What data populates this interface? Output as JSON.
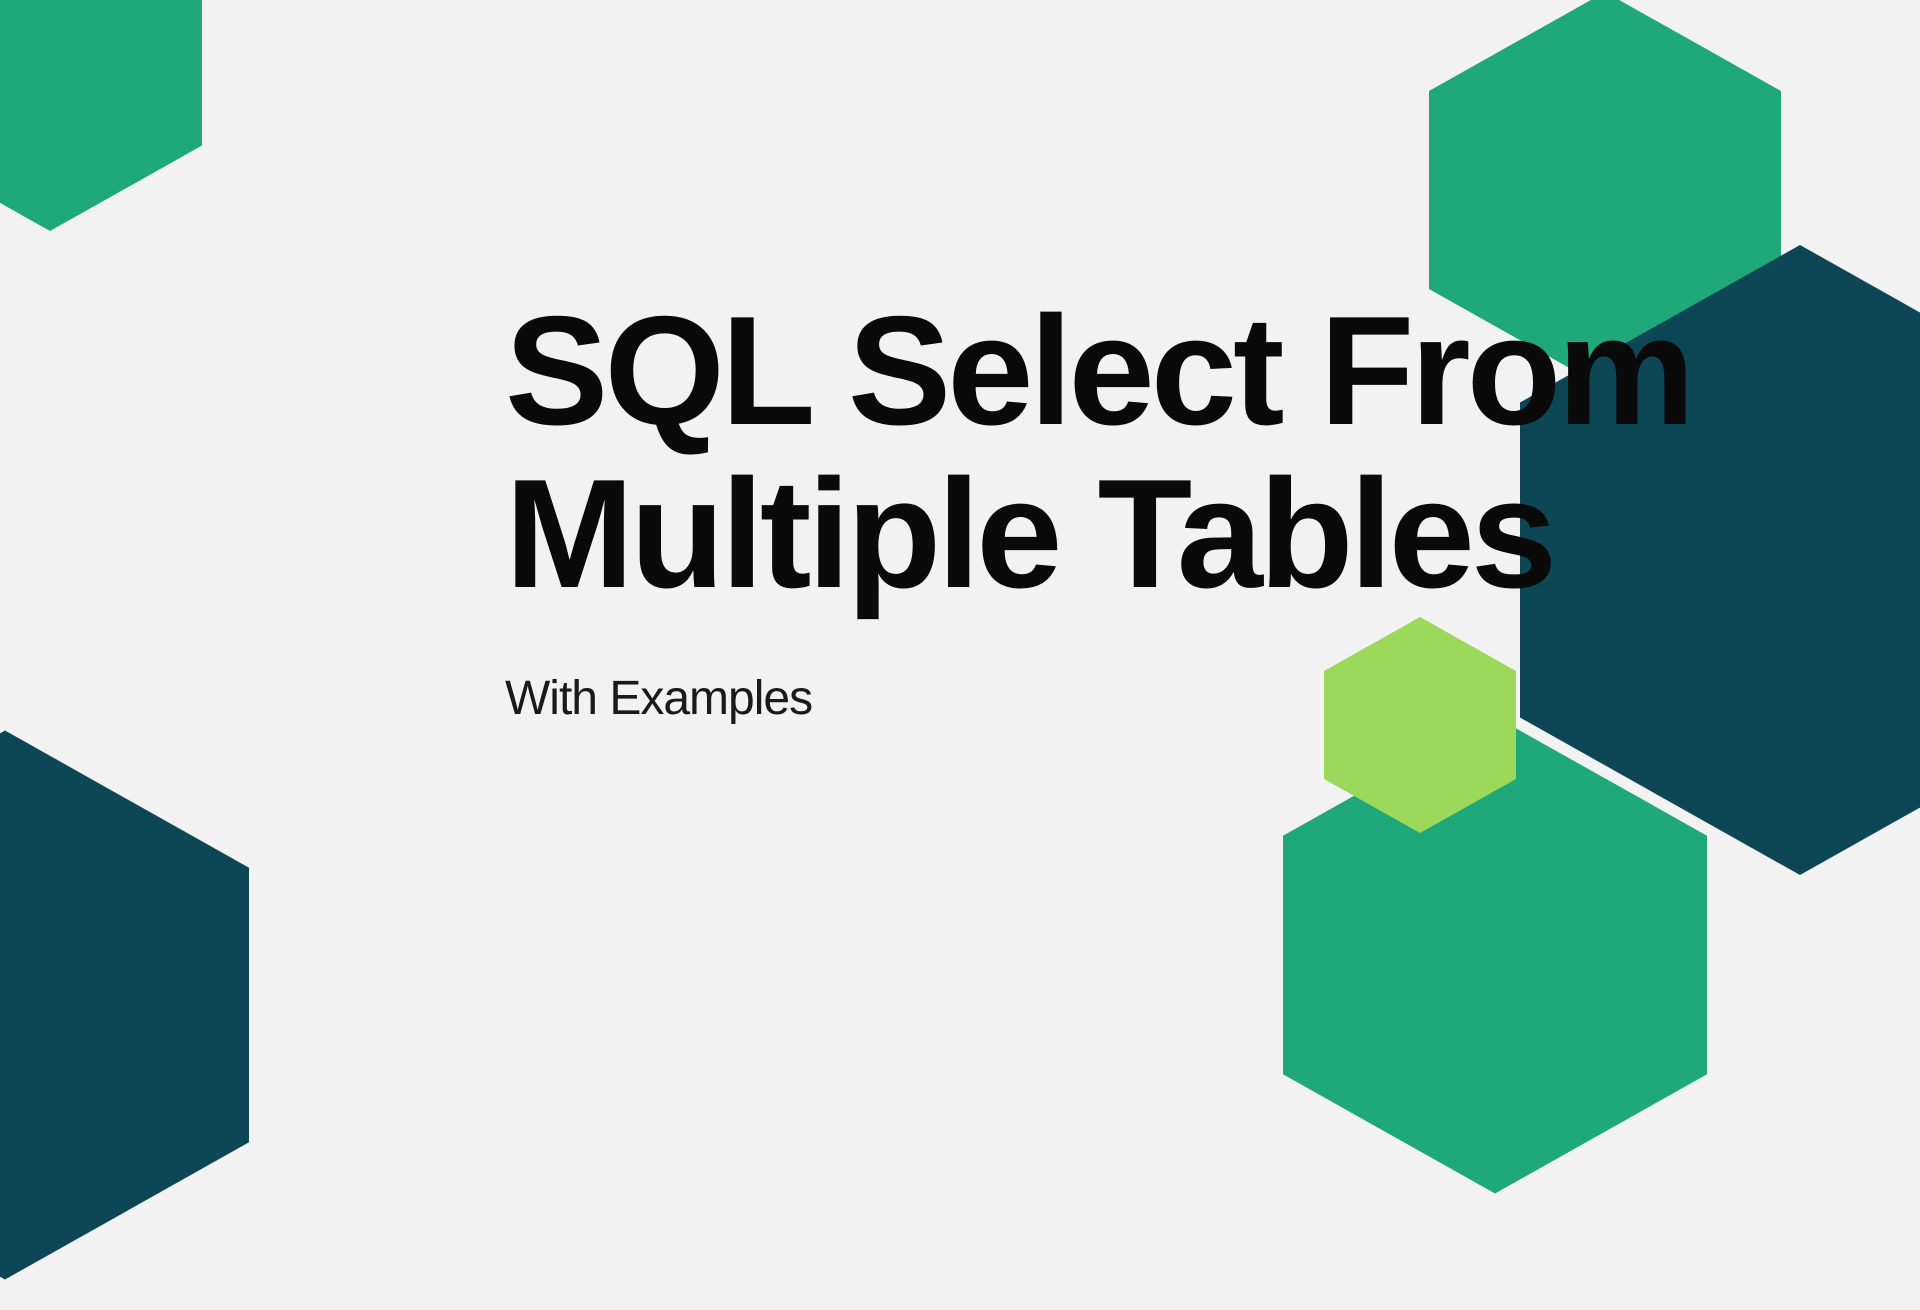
{
  "title": "SQL Select From Multiple Tables",
  "subtitle": "With Examples",
  "colors": {
    "background": "#f1f2f1",
    "teal_green": "#1fa87a",
    "dark_teal": "#0d4654",
    "lime_green": "#9cd95a"
  }
}
